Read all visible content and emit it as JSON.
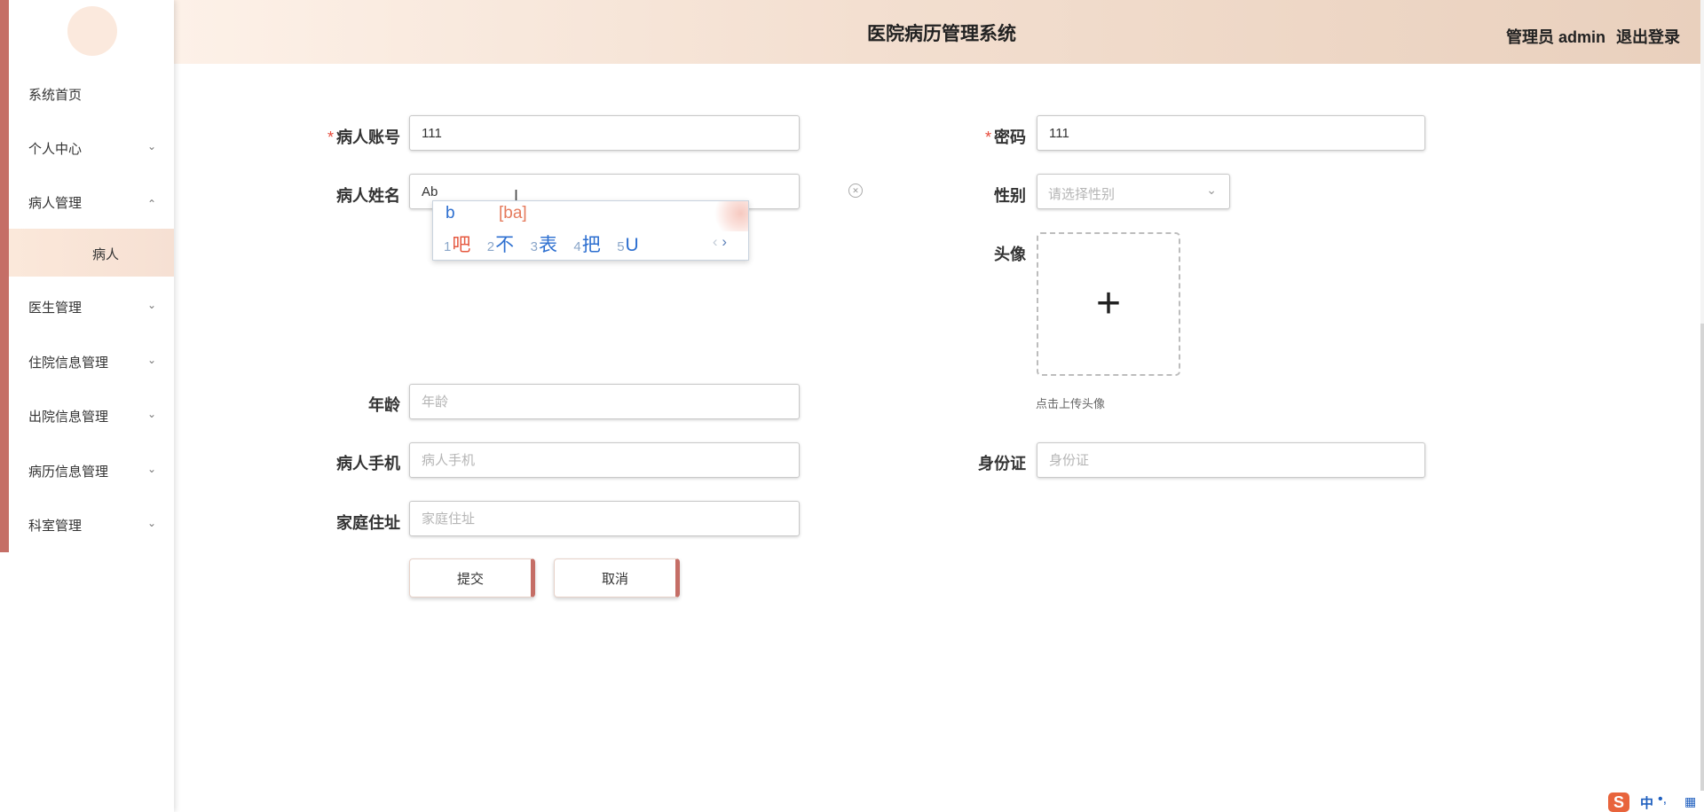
{
  "header": {
    "title": "医院病历管理系统",
    "user": "管理员 admin",
    "logout": "退出登录"
  },
  "sidebar": {
    "items": [
      {
        "label": "系统首页",
        "chevron": ""
      },
      {
        "label": "个人中心",
        "chevron": "⌄"
      },
      {
        "label": "病人管理",
        "chevron": "⌃"
      },
      {
        "label": "病人"
      },
      {
        "label": "医生管理",
        "chevron": "⌄"
      },
      {
        "label": "住院信息管理",
        "chevron": "⌄"
      },
      {
        "label": "出院信息管理",
        "chevron": "⌄"
      },
      {
        "label": "病历信息管理",
        "chevron": "⌄"
      },
      {
        "label": "科室管理",
        "chevron": "⌄"
      }
    ]
  },
  "form": {
    "account": {
      "label": "病人账号",
      "value": "111",
      "required": "*"
    },
    "password": {
      "label": "密码",
      "value": "111",
      "required": "*"
    },
    "name": {
      "label": "病人姓名",
      "value": "Ab"
    },
    "gender": {
      "label": "性别",
      "placeholder": "请选择性别"
    },
    "avatar": {
      "label": "头像",
      "hint": "点击上传头像",
      "plus": "+"
    },
    "age": {
      "label": "年龄",
      "placeholder": "年龄"
    },
    "phone": {
      "label": "病人手机",
      "placeholder": "病人手机"
    },
    "idcard": {
      "label": "身份证",
      "placeholder": "身份证"
    },
    "address": {
      "label": "家庭住址",
      "placeholder": "家庭住址"
    },
    "submit": "提交",
    "cancel": "取消"
  },
  "ime": {
    "typed": "b",
    "pinyin": "[ba]",
    "candidates": [
      {
        "num": "1",
        "text": "吧"
      },
      {
        "num": "2",
        "text": "不"
      },
      {
        "num": "3",
        "text": "表"
      },
      {
        "num": "4",
        "text": "把"
      },
      {
        "num": "5",
        "text": "U"
      }
    ],
    "prev": "‹",
    "next": "›"
  },
  "tray": {
    "logo": "S",
    "mode": "中",
    "punct": "•,",
    "grid": "▦"
  },
  "colors": {
    "accent": "#c56e66",
    "header_start": "#fdf1e8",
    "header_end": "#e9d0bd",
    "required": "#e64a3b"
  }
}
